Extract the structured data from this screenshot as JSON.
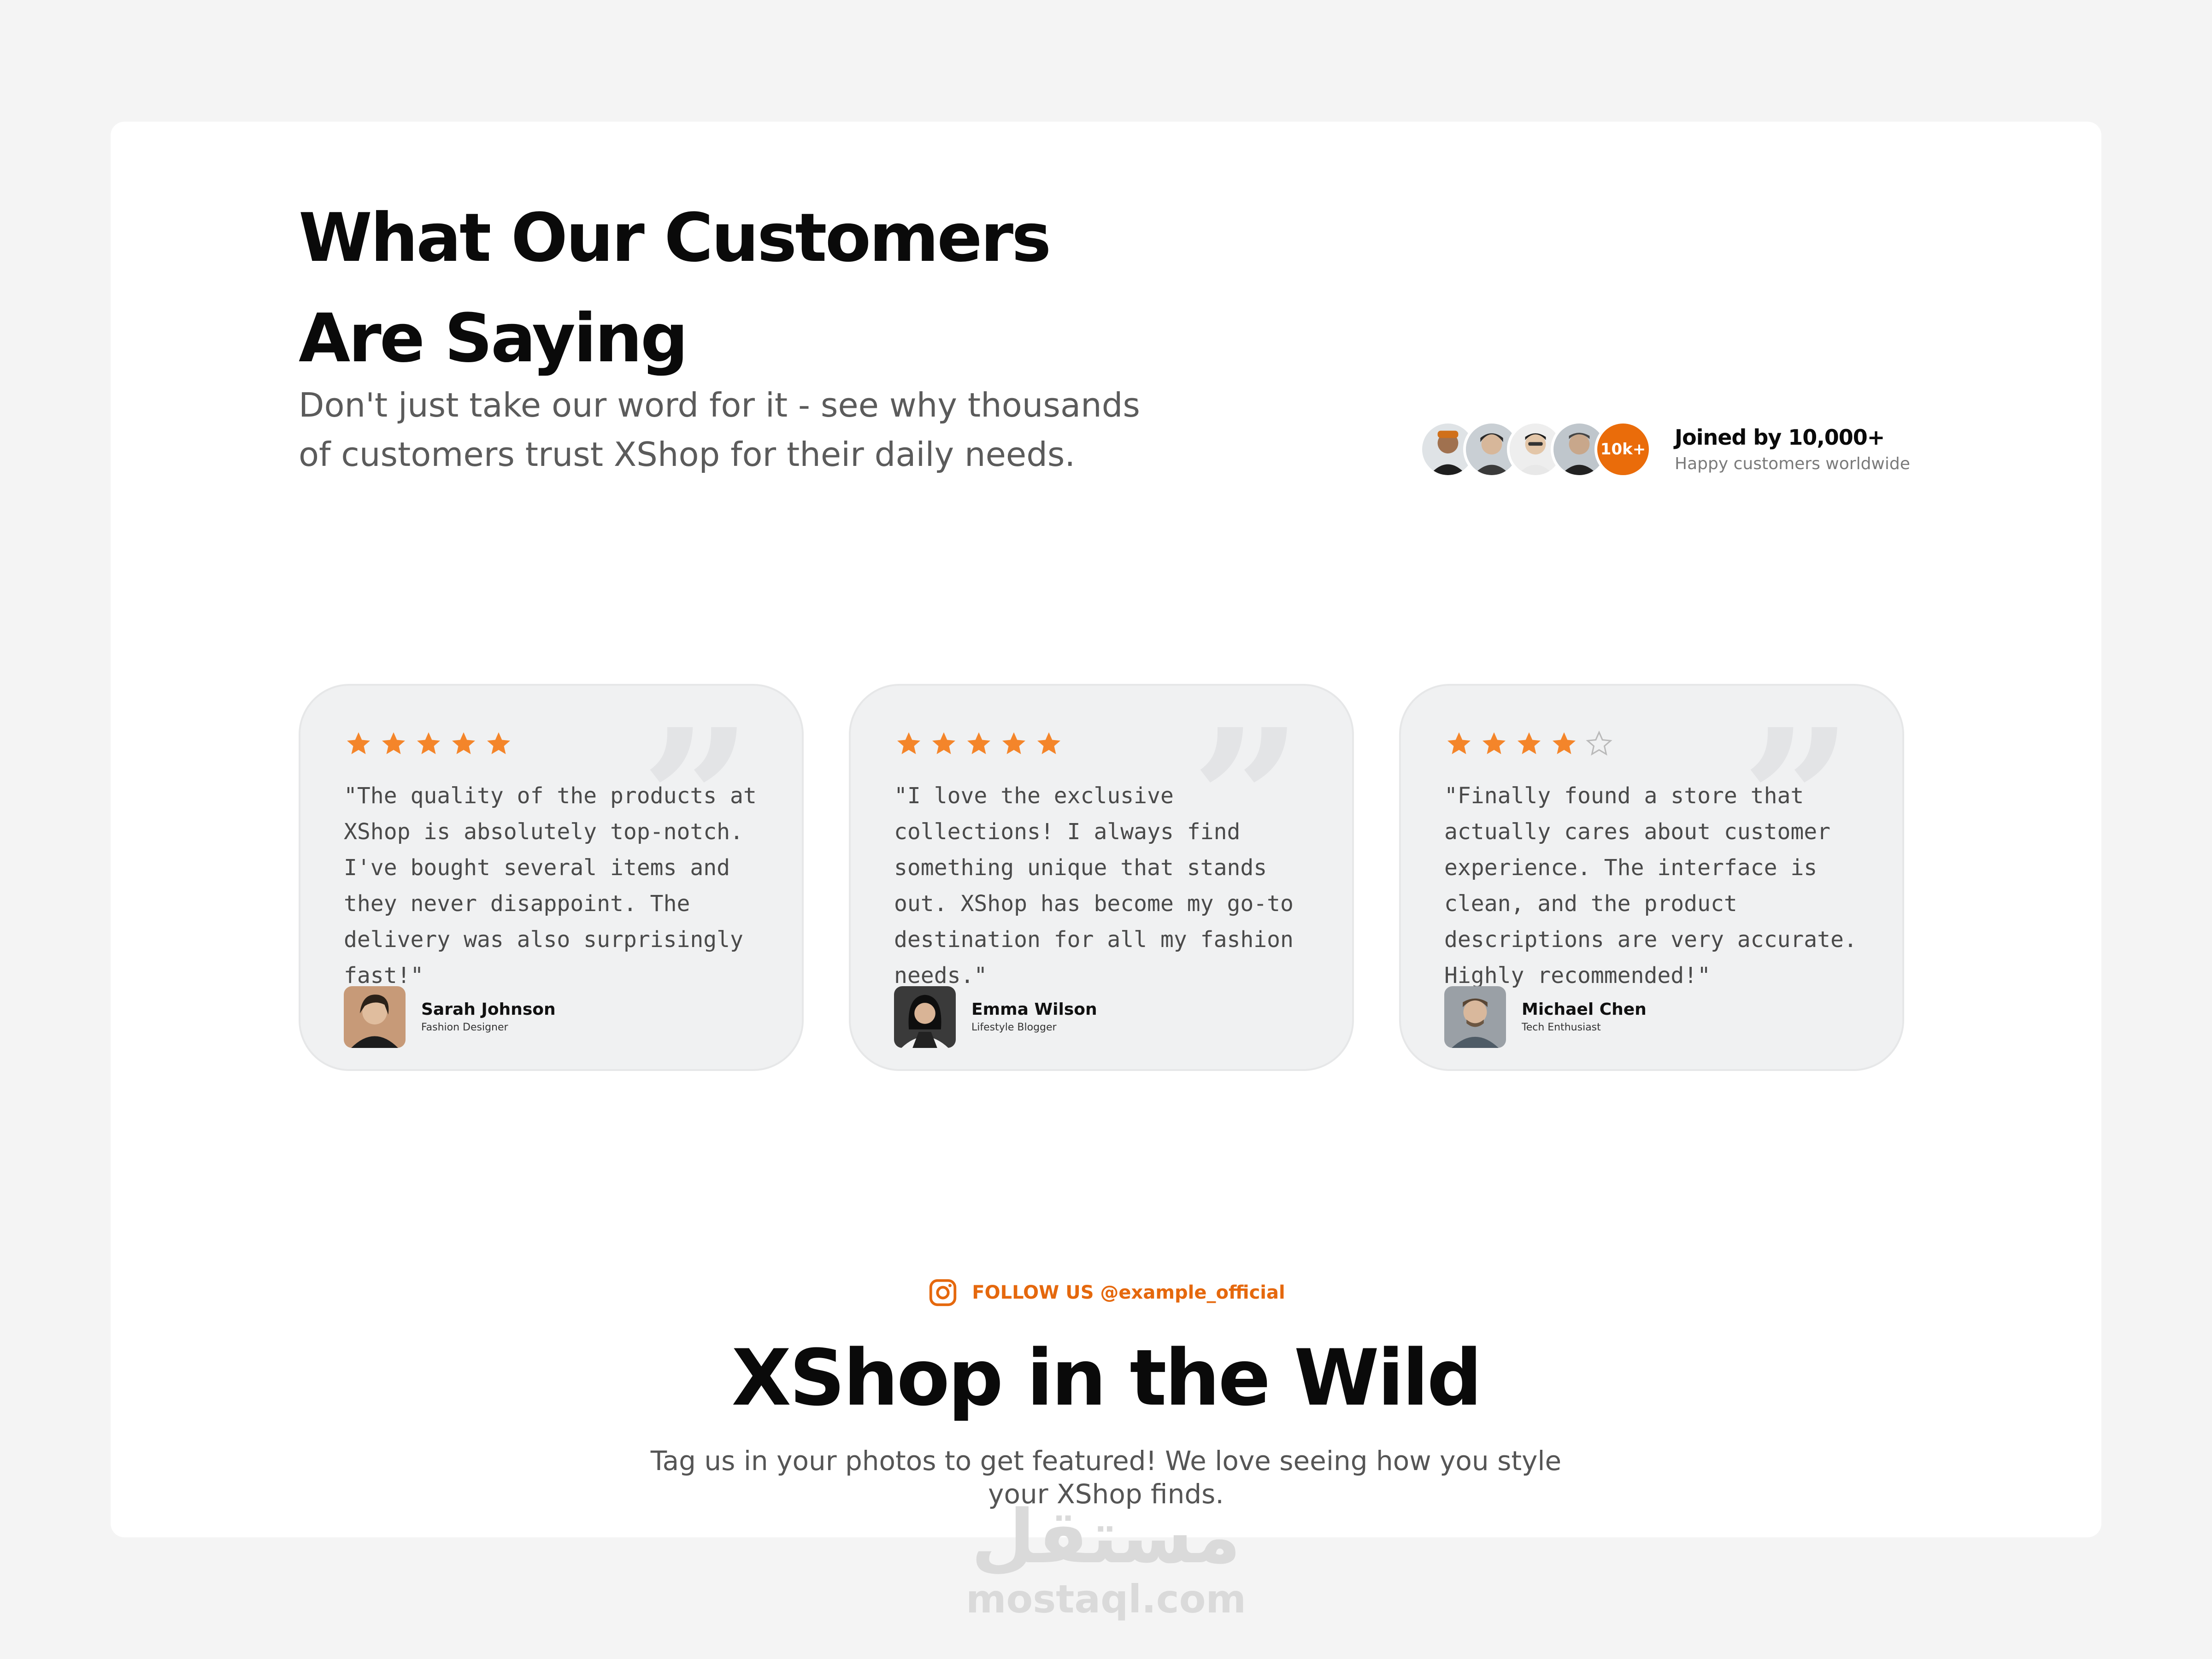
{
  "section": {
    "title_line1": "What Our Customers",
    "title_line2": "Are Saying",
    "subtitle_line1": "Don't just take our word for it - see why thousands",
    "subtitle_line2": "of customers trust XShop for their daily needs."
  },
  "social_proof": {
    "badge": "10k+",
    "title": "Joined by 10,000+",
    "subtitle": "Happy customers worldwide"
  },
  "testimonials": [
    {
      "rating": 5,
      "text": "\"The quality of the products at XShop is absolutely top-notch. I've bought several items and they never disappoint. The delivery was also surprisingly fast!\"",
      "name": "Sarah Johnson",
      "role": "Fashion Designer"
    },
    {
      "rating": 5,
      "text": "\"I love the exclusive collections! I always find something unique that stands out. XShop has become my go-to destination for all my fashion needs.\"",
      "name": "Emma Wilson",
      "role": "Lifestyle Blogger"
    },
    {
      "rating": 4,
      "text": "\"Finally found a store that actually cares about customer experience. The interface is clean, and the product descriptions are very accurate. Highly recommended!\"",
      "name": "Michael Chen",
      "role": "Tech Enthusiast"
    }
  ],
  "wild": {
    "follow": "FOLLOW US @example_official",
    "title": "XShop in the Wild",
    "subtitle": "Tag us in your photos to get featured! We love seeing how you style your XShop finds."
  },
  "watermark": {
    "arabic": "مستقل",
    "latin": "mostaql.com"
  },
  "colors": {
    "accent": "#ea6c0a",
    "star": "#f4852a",
    "card_bg": "#f0f1f2"
  },
  "icons": {
    "star": "star-icon",
    "star_empty": "star-outline-icon",
    "quote": "quote-icon",
    "instagram": "instagram-icon"
  }
}
